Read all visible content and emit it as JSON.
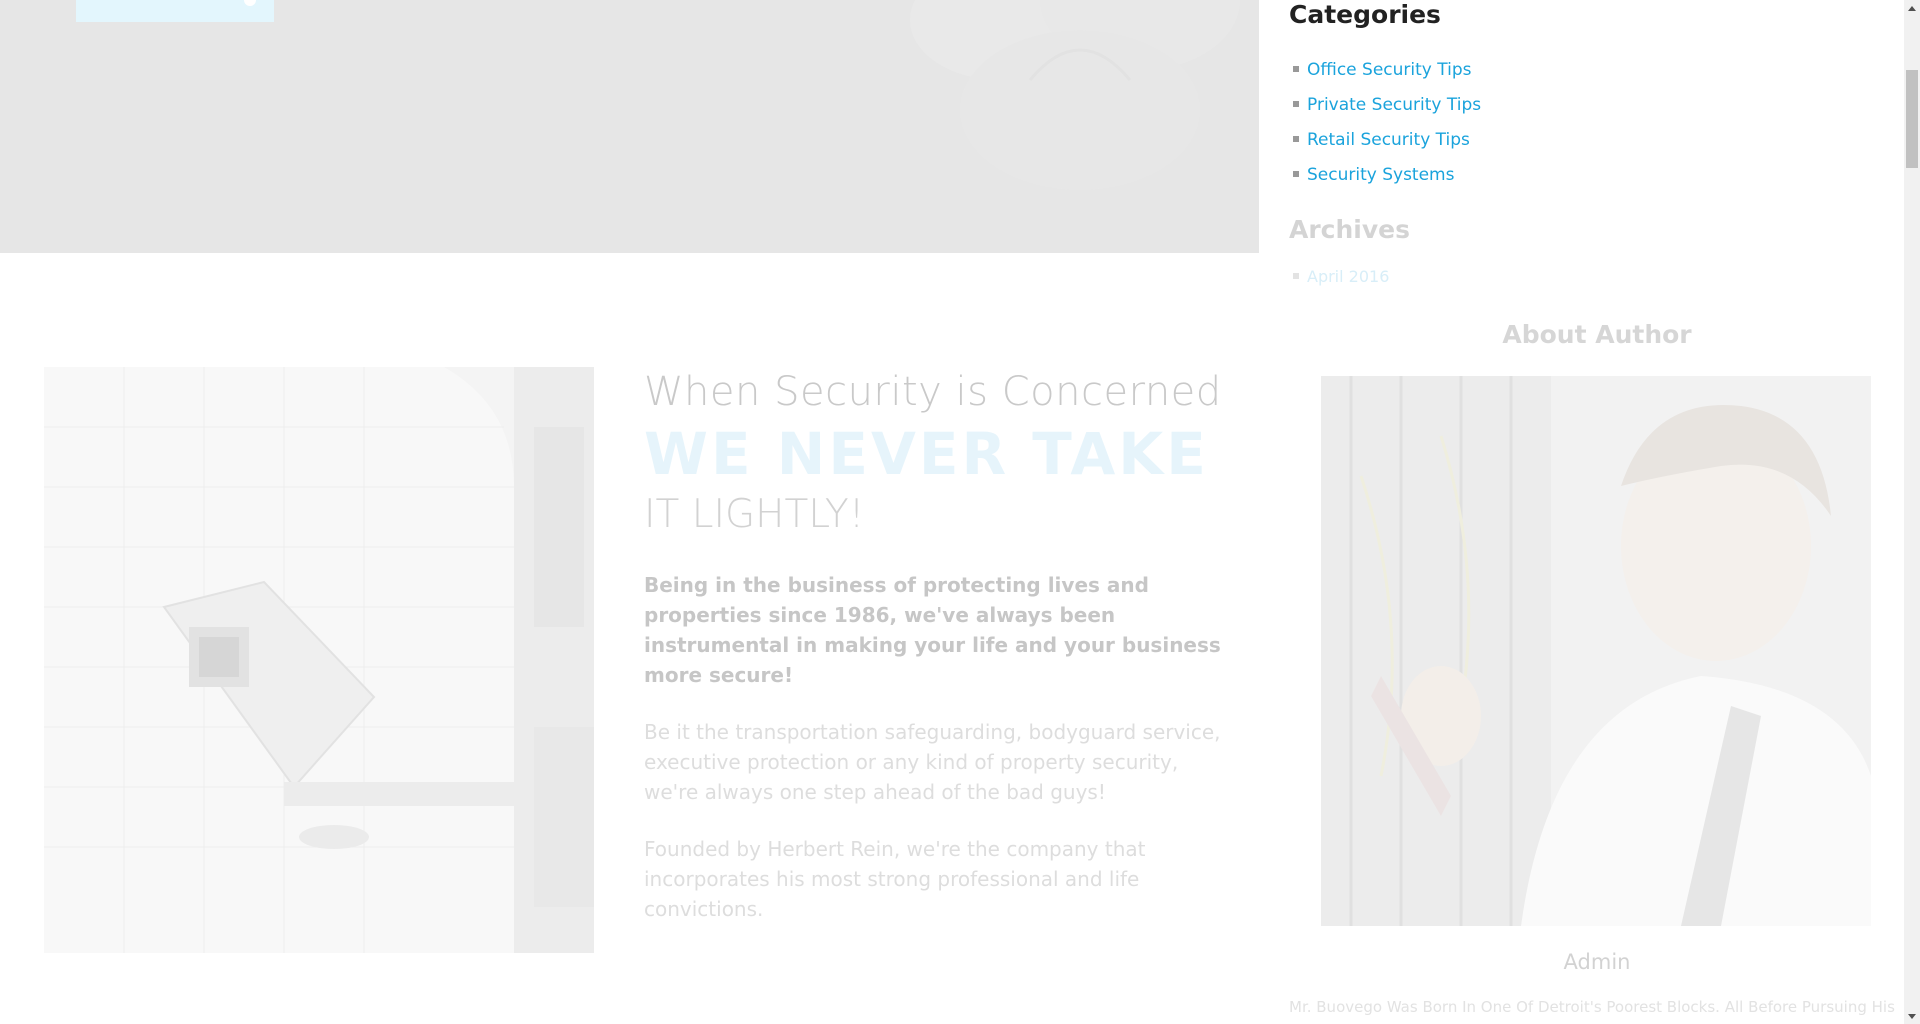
{
  "hero": {
    "button_label": ""
  },
  "feature": {
    "heading_line1": "When Security is Concerned",
    "heading_line2": "WE NEVER TAKE",
    "heading_line3": "IT LIGHTLY!",
    "lead": "Being in the business of protecting lives and properties since 1986, we've always been instrumental in making your life and your business more secure!",
    "paragraph1": "Be it the transportation safeguarding, bodyguard service, executive protection or any kind of property security, we're always one step ahead of the bad guys!",
    "paragraph2": "Founded by Herbert Rein, we're the company that incorporates his most strong professional and life convictions."
  },
  "sidebar": {
    "categories_title": "Categories",
    "categories": [
      {
        "label": "Office Security Tips"
      },
      {
        "label": "Private Security Tips"
      },
      {
        "label": "Retail Security Tips"
      },
      {
        "label": "Security Systems"
      }
    ],
    "archives_title": "Archives",
    "archives": [
      {
        "label": "April 2016"
      }
    ],
    "about_title": "About Author",
    "author_name": "Admin",
    "author_bio": "Mr. Buovego Was Born In One Of Detroit's Poorest Blocks. All Before Pursuing His"
  },
  "colors": {
    "link": "#1aa3dc",
    "heading_dark": "#222222",
    "faded_text": "#c9c9c9"
  }
}
